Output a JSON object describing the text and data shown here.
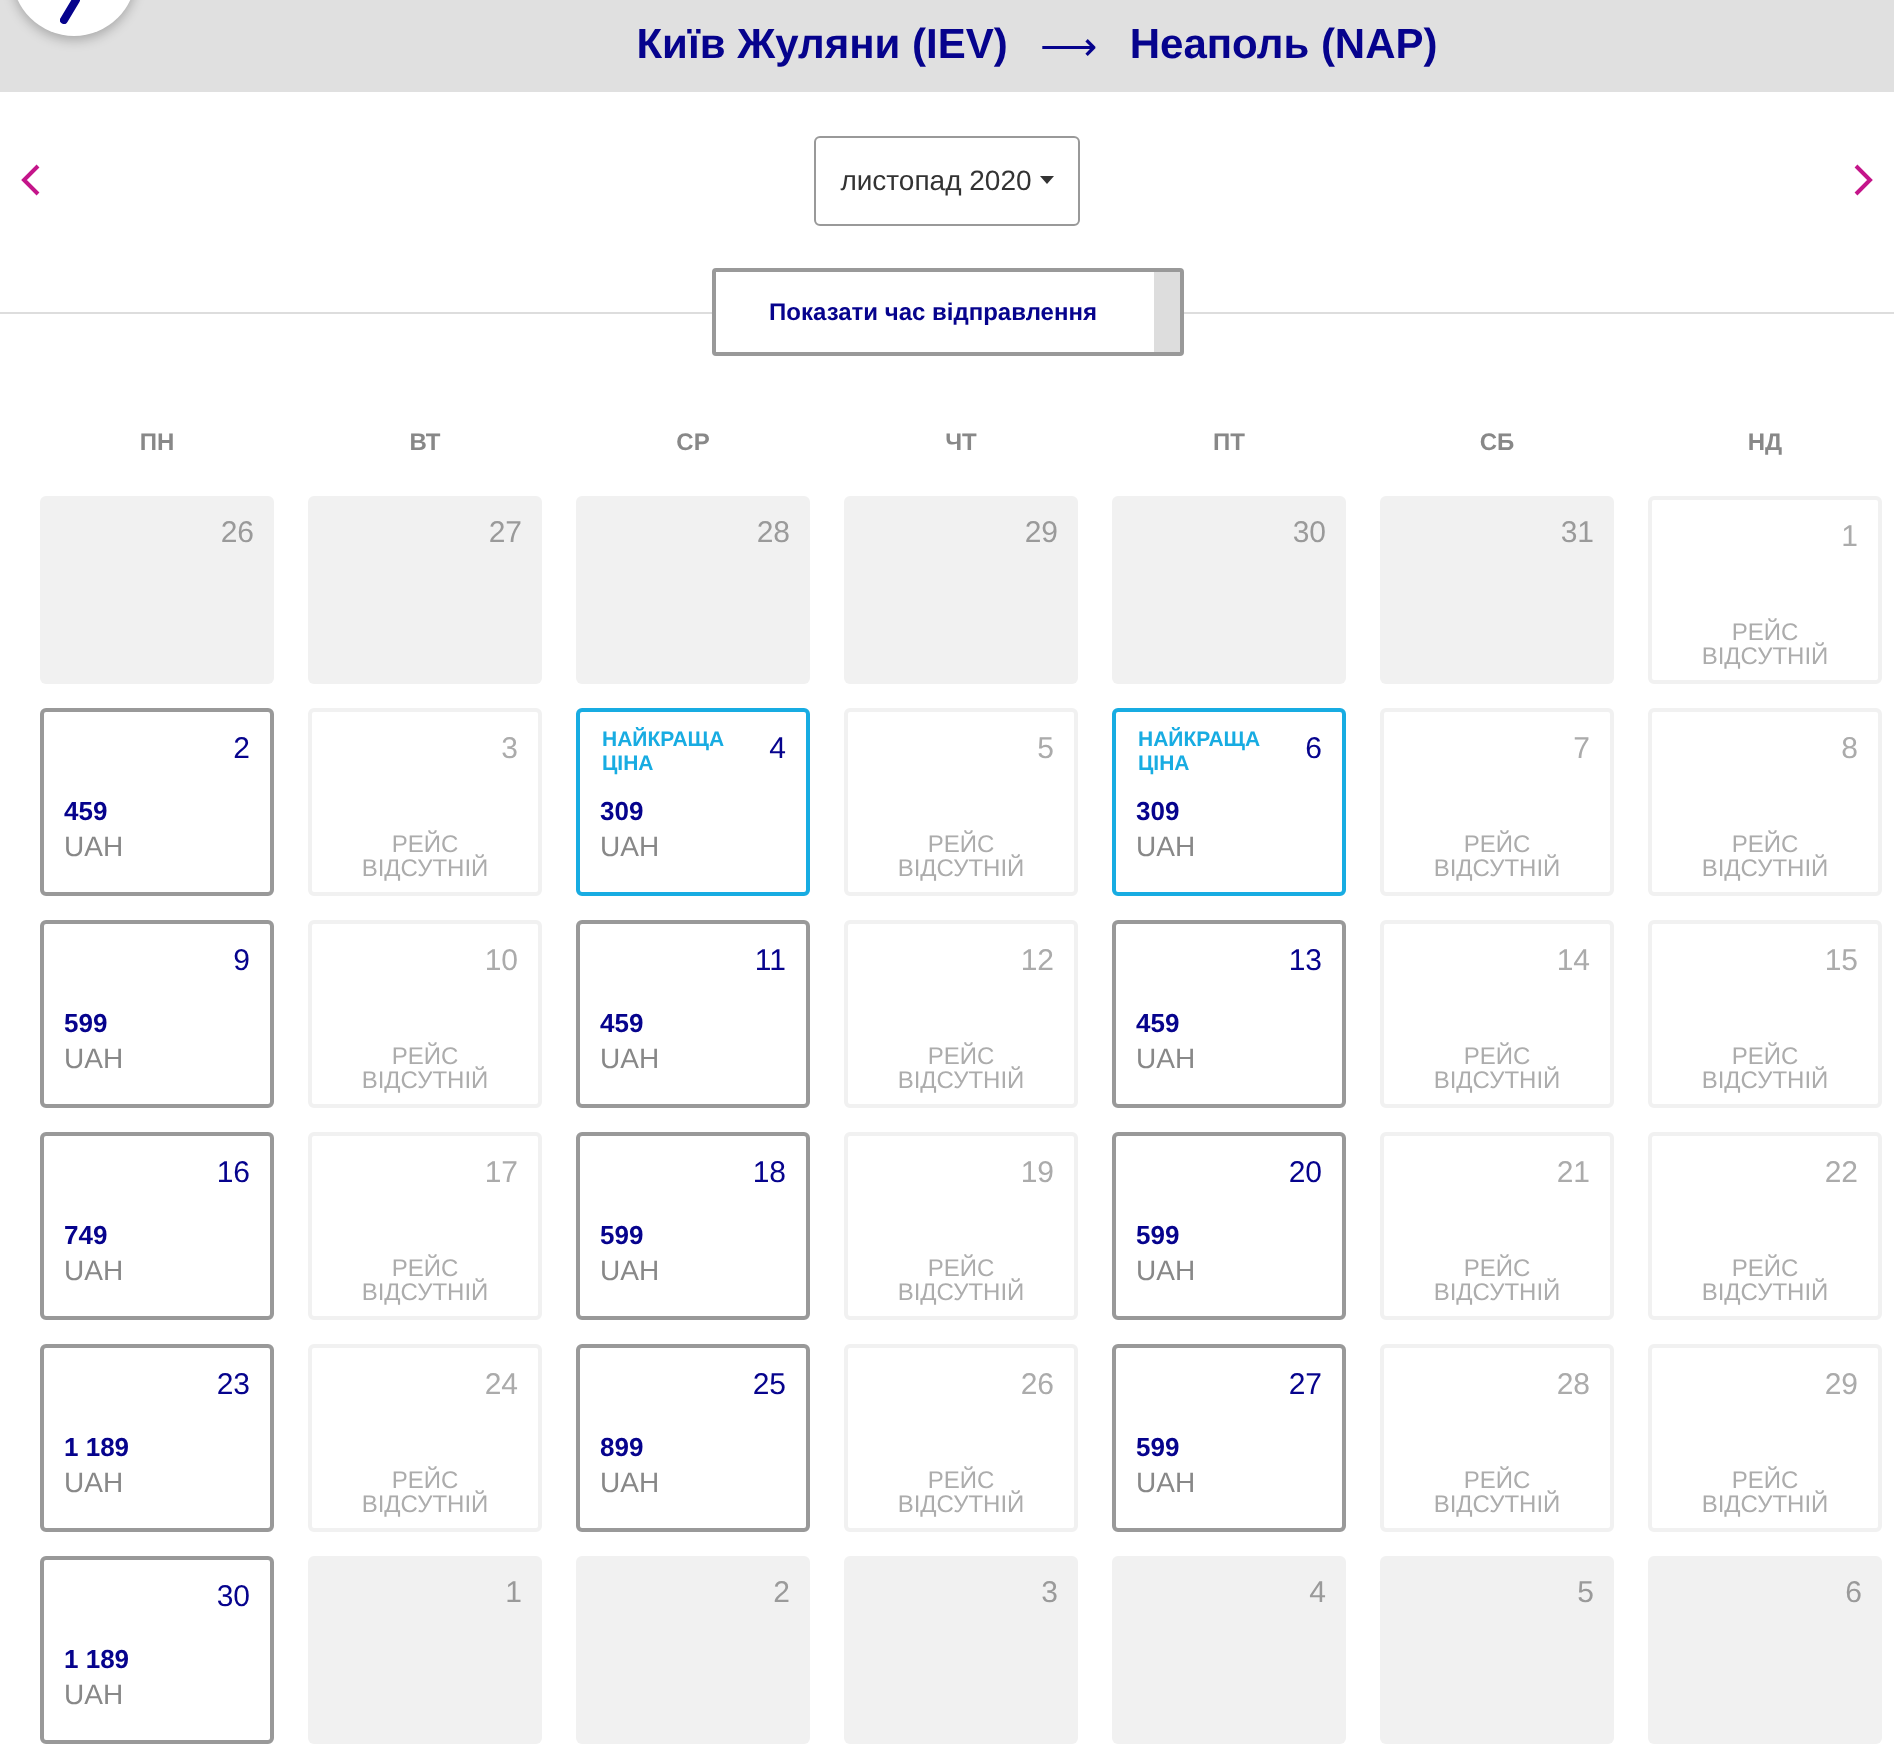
{
  "header": {
    "origin": "Київ Жуляни (IEV)",
    "arrow": "⟶",
    "destination": "Неаполь (NAP)"
  },
  "month_picker": {
    "value": "листопад 2020"
  },
  "toggle_button": {
    "label": "Показати час відправлення"
  },
  "weekdays": [
    "ПН",
    "ВТ",
    "СР",
    "ЧТ",
    "ПТ",
    "СБ",
    "НД"
  ],
  "weeks": [
    [
      {
        "day": "26",
        "kind": "outside"
      },
      {
        "day": "27",
        "kind": "outside"
      },
      {
        "day": "28",
        "kind": "outside"
      },
      {
        "day": "29",
        "kind": "outside"
      },
      {
        "day": "30",
        "kind": "outside"
      },
      {
        "day": "31",
        "kind": "outside"
      },
      {
        "day": "1",
        "kind": "nofare",
        "note": "РЕЙС ВІДСУТНІЙ"
      }
    ],
    [
      {
        "day": "2",
        "kind": "fare",
        "price": "459",
        "currency": "UAH",
        "best": false
      },
      {
        "day": "3",
        "kind": "nofare",
        "note": "РЕЙС ВІДСУТНІЙ"
      },
      {
        "day": "4",
        "kind": "fare",
        "badge": "НАЙКРАЩА ЦІНА",
        "price": "309",
        "currency": "UAH",
        "best": true
      },
      {
        "day": "5",
        "kind": "nofare",
        "note": "РЕЙС ВІДСУТНІЙ"
      },
      {
        "day": "6",
        "kind": "fare",
        "badge": "НАЙКРАЩА ЦІНА",
        "price": "309",
        "currency": "UAH",
        "best": true
      },
      {
        "day": "7",
        "kind": "nofare",
        "note": "РЕЙС ВІДСУТНІЙ"
      },
      {
        "day": "8",
        "kind": "nofare",
        "note": "РЕЙС ВІДСУТНІЙ"
      }
    ],
    [
      {
        "day": "9",
        "kind": "fare",
        "price": "599",
        "currency": "UAH",
        "best": false
      },
      {
        "day": "10",
        "kind": "nofare",
        "note": "РЕЙС ВІДСУТНІЙ"
      },
      {
        "day": "11",
        "kind": "fare",
        "price": "459",
        "currency": "UAH",
        "best": false
      },
      {
        "day": "12",
        "kind": "nofare",
        "note": "РЕЙС ВІДСУТНІЙ"
      },
      {
        "day": "13",
        "kind": "fare",
        "price": "459",
        "currency": "UAH",
        "best": false
      },
      {
        "day": "14",
        "kind": "nofare",
        "note": "РЕЙС ВІДСУТНІЙ"
      },
      {
        "day": "15",
        "kind": "nofare",
        "note": "РЕЙС ВІДСУТНІЙ"
      }
    ],
    [
      {
        "day": "16",
        "kind": "fare",
        "price": "749",
        "currency": "UAH",
        "best": false
      },
      {
        "day": "17",
        "kind": "nofare",
        "note": "РЕЙС ВІДСУТНІЙ"
      },
      {
        "day": "18",
        "kind": "fare",
        "price": "599",
        "currency": "UAH",
        "best": false
      },
      {
        "day": "19",
        "kind": "nofare",
        "note": "РЕЙС ВІДСУТНІЙ"
      },
      {
        "day": "20",
        "kind": "fare",
        "price": "599",
        "currency": "UAH",
        "best": false
      },
      {
        "day": "21",
        "kind": "nofare",
        "note": "РЕЙС ВІДСУТНІЙ"
      },
      {
        "day": "22",
        "kind": "nofare",
        "note": "РЕЙС ВІДСУТНІЙ"
      }
    ],
    [
      {
        "day": "23",
        "kind": "fare",
        "price": "1 189",
        "currency": "UAH",
        "best": false
      },
      {
        "day": "24",
        "kind": "nofare",
        "note": "РЕЙС ВІДСУТНІЙ"
      },
      {
        "day": "25",
        "kind": "fare",
        "price": "899",
        "currency": "UAH",
        "best": false
      },
      {
        "day": "26",
        "kind": "nofare",
        "note": "РЕЙС ВІДСУТНІЙ"
      },
      {
        "day": "27",
        "kind": "fare",
        "price": "599",
        "currency": "UAH",
        "best": false
      },
      {
        "day": "28",
        "kind": "nofare",
        "note": "РЕЙС ВІДСУТНІЙ"
      },
      {
        "day": "29",
        "kind": "nofare",
        "note": "РЕЙС ВІДСУТНІЙ"
      }
    ],
    [
      {
        "day": "30",
        "kind": "fare",
        "price": "1 189",
        "currency": "UAH",
        "best": false
      },
      {
        "day": "1",
        "kind": "outside"
      },
      {
        "day": "2",
        "kind": "outside"
      },
      {
        "day": "3",
        "kind": "outside"
      },
      {
        "day": "4",
        "kind": "outside"
      },
      {
        "day": "5",
        "kind": "outside"
      },
      {
        "day": "6",
        "kind": "outside"
      }
    ]
  ]
}
